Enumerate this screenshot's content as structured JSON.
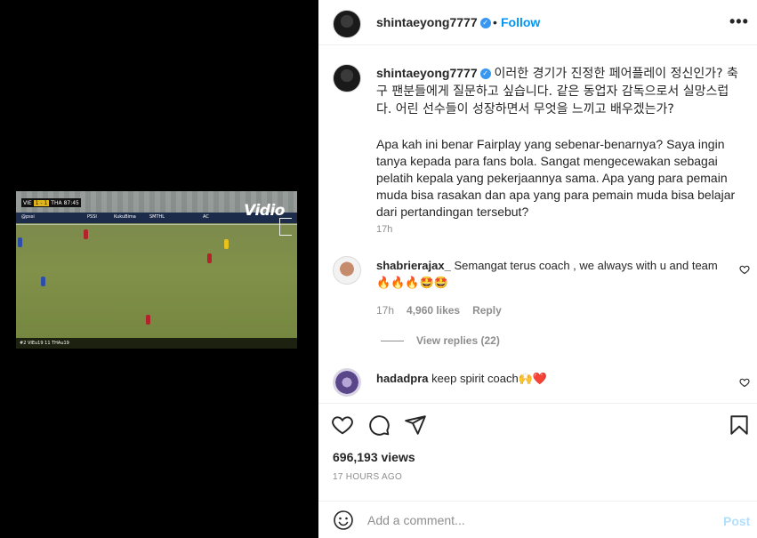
{
  "video": {
    "brand": "Vidio",
    "scoreboard": {
      "home": "VIE",
      "score": "1 - 1",
      "away": "THA",
      "clock": "87:45"
    },
    "ads": [
      "@pssi",
      "PSSI",
      "KukuBima",
      "SMTHL",
      "AC"
    ],
    "caption": "#2 VIEu19 11 THAu19"
  },
  "header": {
    "username": "shintaeyong7777",
    "verified_glyph": "✓",
    "follow_label": "Follow",
    "more_glyph": "•••"
  },
  "post_caption": {
    "username": "shintaeyong7777",
    "korean": "이러한 경기가 진정한 페어플레이 정신인가? 축구 팬분들에게 질문하고 싶습니다. 같은 동업자 감독으로서 실망스럽다. 어린 선수들이 성장하면서 무엇을 느끼고 배우겠는가?",
    "indonesian": "Apa kah ini benar Fairplay yang sebenar-benarnya? Saya ingin tanya kepada para fans bola. Sangat mengecewakan sebagai pelatih kepala yang pekerjaannya sama. Apa yang para pemain muda bisa rasakan dan apa yang para pemain muda bisa belajar dari pertandingan tersebut?",
    "time": "17h"
  },
  "comments": [
    {
      "username": "shabrierajax_",
      "text": "Semangat terus coach , we always with u and team 🔥🔥🔥🤩🤩",
      "time": "17h",
      "likes": "4,960 likes",
      "reply_label": "Reply",
      "view_replies": "View replies (22)"
    },
    {
      "username": "hadadpra",
      "text": "keep spirit coach🙌❤️"
    }
  ],
  "stats": {
    "views": "696,193 views",
    "posted": "17 HOURS AGO"
  },
  "comment_input": {
    "placeholder": "Add a comment...",
    "post_label": "Post"
  },
  "icons": [
    "heart-icon",
    "comment-icon",
    "share-icon",
    "bookmark-icon",
    "smiley-icon",
    "more-icon",
    "verified-badge-icon"
  ],
  "colors": {
    "follow_blue": "#0095f6",
    "post_disabled": "#b2dffc",
    "secondary_text": "#8e8e8e"
  }
}
